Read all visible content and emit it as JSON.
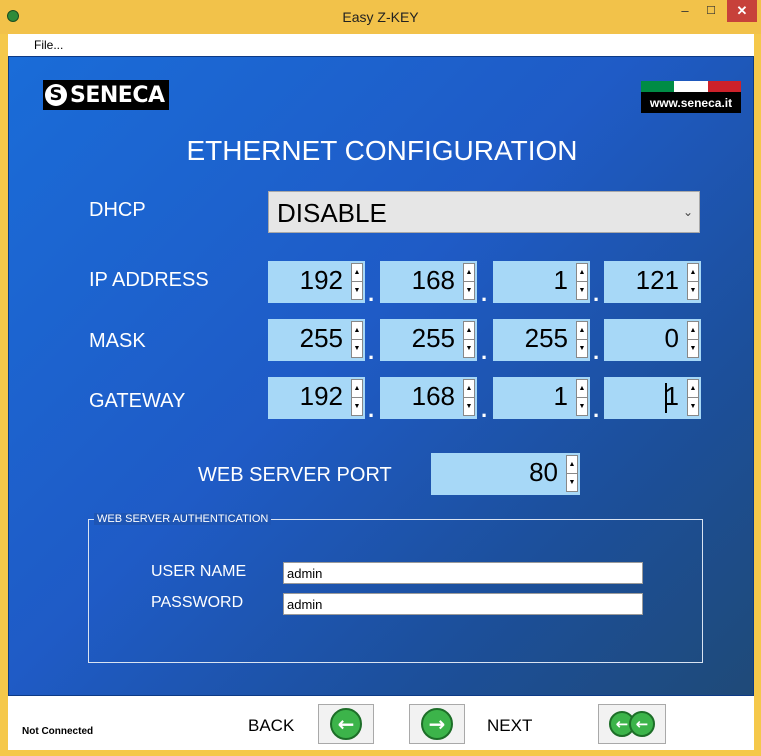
{
  "window": {
    "title": "Easy Z-KEY",
    "min_glyph": "–",
    "max_glyph": "☐",
    "close_glyph": "✕"
  },
  "menu": {
    "file": "File..."
  },
  "logos": {
    "seneca_mark": "S",
    "seneca_text": "SENECA",
    "website": "www.seneca.it",
    "flag_colors": [
      "#008c45",
      "#ffffff",
      "#cd212a"
    ]
  },
  "page": {
    "title": "ETHERNET CONFIGURATION"
  },
  "dhcp": {
    "label": "DHCP",
    "value": "DISABLE",
    "arrow": "⌄"
  },
  "ip_address": {
    "label": "IP ADDRESS",
    "octets": [
      "192",
      "168",
      "1",
      "121"
    ]
  },
  "mask": {
    "label": "MASK",
    "octets": [
      "255",
      "255",
      "255",
      "0"
    ]
  },
  "gateway": {
    "label": "GATEWAY",
    "octets": [
      "192",
      "168",
      "1",
      "1"
    ]
  },
  "separator": ".",
  "spin": {
    "up": "▲",
    "down": "▼"
  },
  "web_server_port": {
    "label": "WEB SERVER PORT",
    "value": "80"
  },
  "auth": {
    "legend": "WEB SERVER AUTHENTICATION",
    "user_label": "USER NAME",
    "user_value": "admin",
    "password_label": "PASSWORD",
    "password_value": "admin"
  },
  "status": {
    "text": "Not Connected"
  },
  "nav": {
    "back_label": "BACK",
    "next_label": "NEXT",
    "back_glyph": "←",
    "next_glyph": "→",
    "fast_glyph": "←"
  }
}
